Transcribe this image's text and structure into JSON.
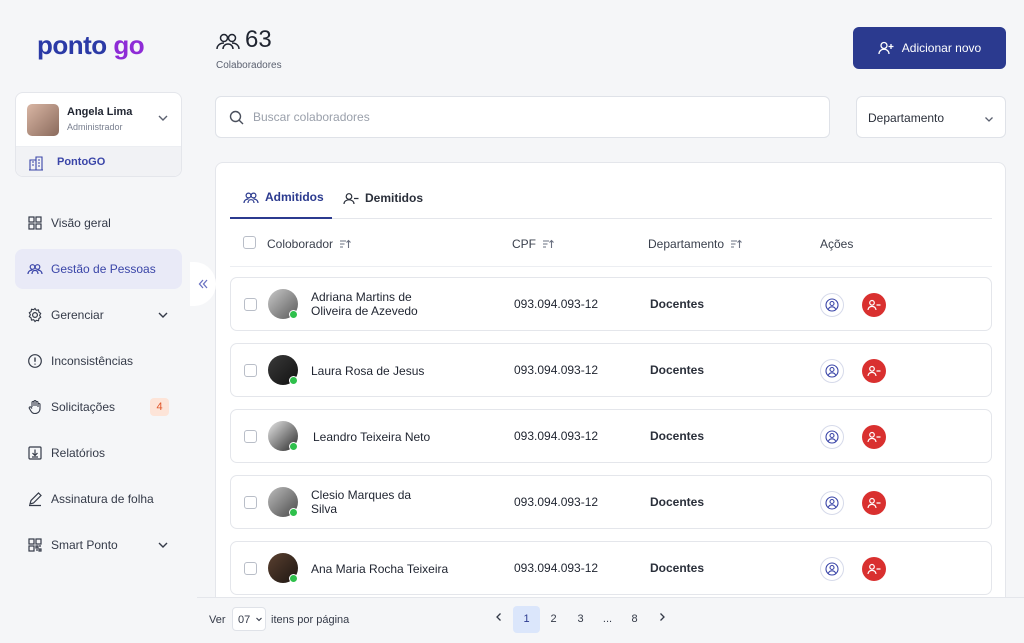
{
  "brand": {
    "logo_part1": "ponto",
    "logo_part2": "go"
  },
  "user": {
    "name": "Angela Lima",
    "role": "Administrador",
    "company": "PontoGO"
  },
  "nav": {
    "items": [
      {
        "label": "Visão geral"
      },
      {
        "label": "Gestão de Pessoas"
      },
      {
        "label": "Gerenciar"
      },
      {
        "label": "Inconsistências"
      },
      {
        "label": "Solicitações",
        "badge": "4"
      },
      {
        "label": "Relatórios"
      },
      {
        "label": "Assinatura de folha"
      },
      {
        "label": "Smart Ponto"
      }
    ]
  },
  "header": {
    "count": "63",
    "count_label": "Colaboradores",
    "add_label": "Adicionar novo"
  },
  "search": {
    "placeholder": "Buscar colaboradores"
  },
  "filter": {
    "department": "Departamento"
  },
  "tabs": [
    {
      "label": "Admitidos"
    },
    {
      "label": "Demitidos"
    }
  ],
  "table": {
    "columns": [
      "Coloborador",
      "CPF",
      "Departamento",
      "Ações"
    ],
    "rows": [
      {
        "name": "Adriana Martins de Oliveira de Azevedo",
        "cpf": "093.094.093-12",
        "dept": "Docentes"
      },
      {
        "name": "Laura Rosa de Jesus",
        "cpf": "093.094.093-12",
        "dept": "Docentes"
      },
      {
        "name": "Leandro Teixeira Neto",
        "cpf": "093.094.093-12",
        "dept": "Docentes"
      },
      {
        "name": "Clesio Marques da Silva",
        "cpf": "093.094.093-12",
        "dept": "Docentes"
      },
      {
        "name": "Ana Maria Rocha Teixeira",
        "cpf": "093.094.093-12",
        "dept": "Docentes"
      }
    ]
  },
  "pagination": {
    "ver_label": "Ver",
    "per_page": "07",
    "per_page_label": "itens por página",
    "pages": [
      "1",
      "2",
      "3",
      "...",
      "8"
    ],
    "current": "1"
  },
  "colors": {
    "primary": "#2b3a8f",
    "accent": "#8e2bd6",
    "danger": "#d9302f",
    "online": "#2ec04b"
  }
}
